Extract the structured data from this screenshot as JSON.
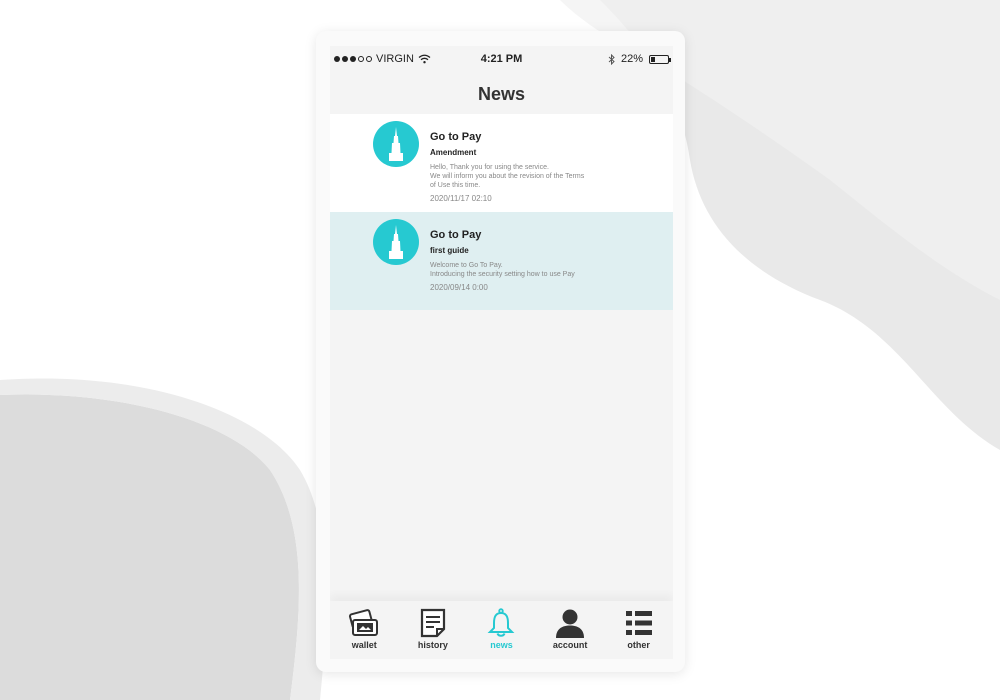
{
  "status_bar": {
    "carrier": "VIRGIN",
    "time": "4:21 PM",
    "battery_percent": "22%",
    "battery_level": 0.22
  },
  "header": {
    "title": "News"
  },
  "news": {
    "items": [
      {
        "sender": "Go to Pay",
        "subject": "Amendment",
        "body": "Hello, Thank you for using the service.\nWe will inform you about the revision of the Terms\nof Use this time.",
        "date": "2020/11/17 02:10"
      },
      {
        "sender": "Go to Pay",
        "subject": "first guide",
        "body": "Welcome to Go To Pay.\nIntroducing the security setting how to use Pay",
        "date": "2020/09/14 0:00"
      }
    ]
  },
  "tabs": [
    {
      "label": "wallet",
      "icon": "wallet-icon"
    },
    {
      "label": "history",
      "icon": "history-icon"
    },
    {
      "label": "news",
      "icon": "bell-icon",
      "active": true
    },
    {
      "label": "account",
      "icon": "account-icon"
    },
    {
      "label": "other",
      "icon": "list-icon"
    }
  ],
  "colors": {
    "accent": "#26c9d1",
    "selected_row": "#dfeff1",
    "screen_bg": "#f4f4f4"
  }
}
